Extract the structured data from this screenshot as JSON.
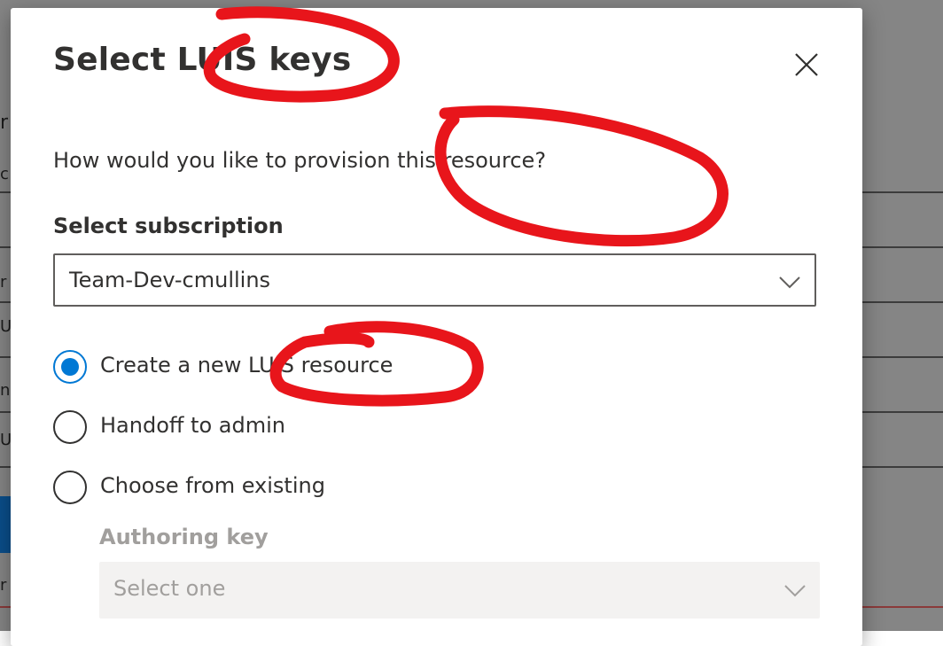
{
  "dialog": {
    "title": "Select LUIS keys",
    "close_icon": "close-icon",
    "question": "How would you like to provision this resource?"
  },
  "subscription": {
    "label": "Select subscription",
    "value": "Team-Dev-cmullins",
    "icon": "chevron-down-icon"
  },
  "radio_options": [
    {
      "label": "Create a new LUIS resource",
      "checked": true
    },
    {
      "label": "Handoff to admin",
      "checked": false
    },
    {
      "label": "Choose from existing",
      "checked": false
    }
  ],
  "authoring_key": {
    "label": "Authoring key",
    "placeholder": "Select one",
    "disabled": true
  },
  "colors": {
    "accent": "#0078d4",
    "text": "#323130",
    "disabled_text": "#a19f9d",
    "annotation": "#e8151b"
  }
}
